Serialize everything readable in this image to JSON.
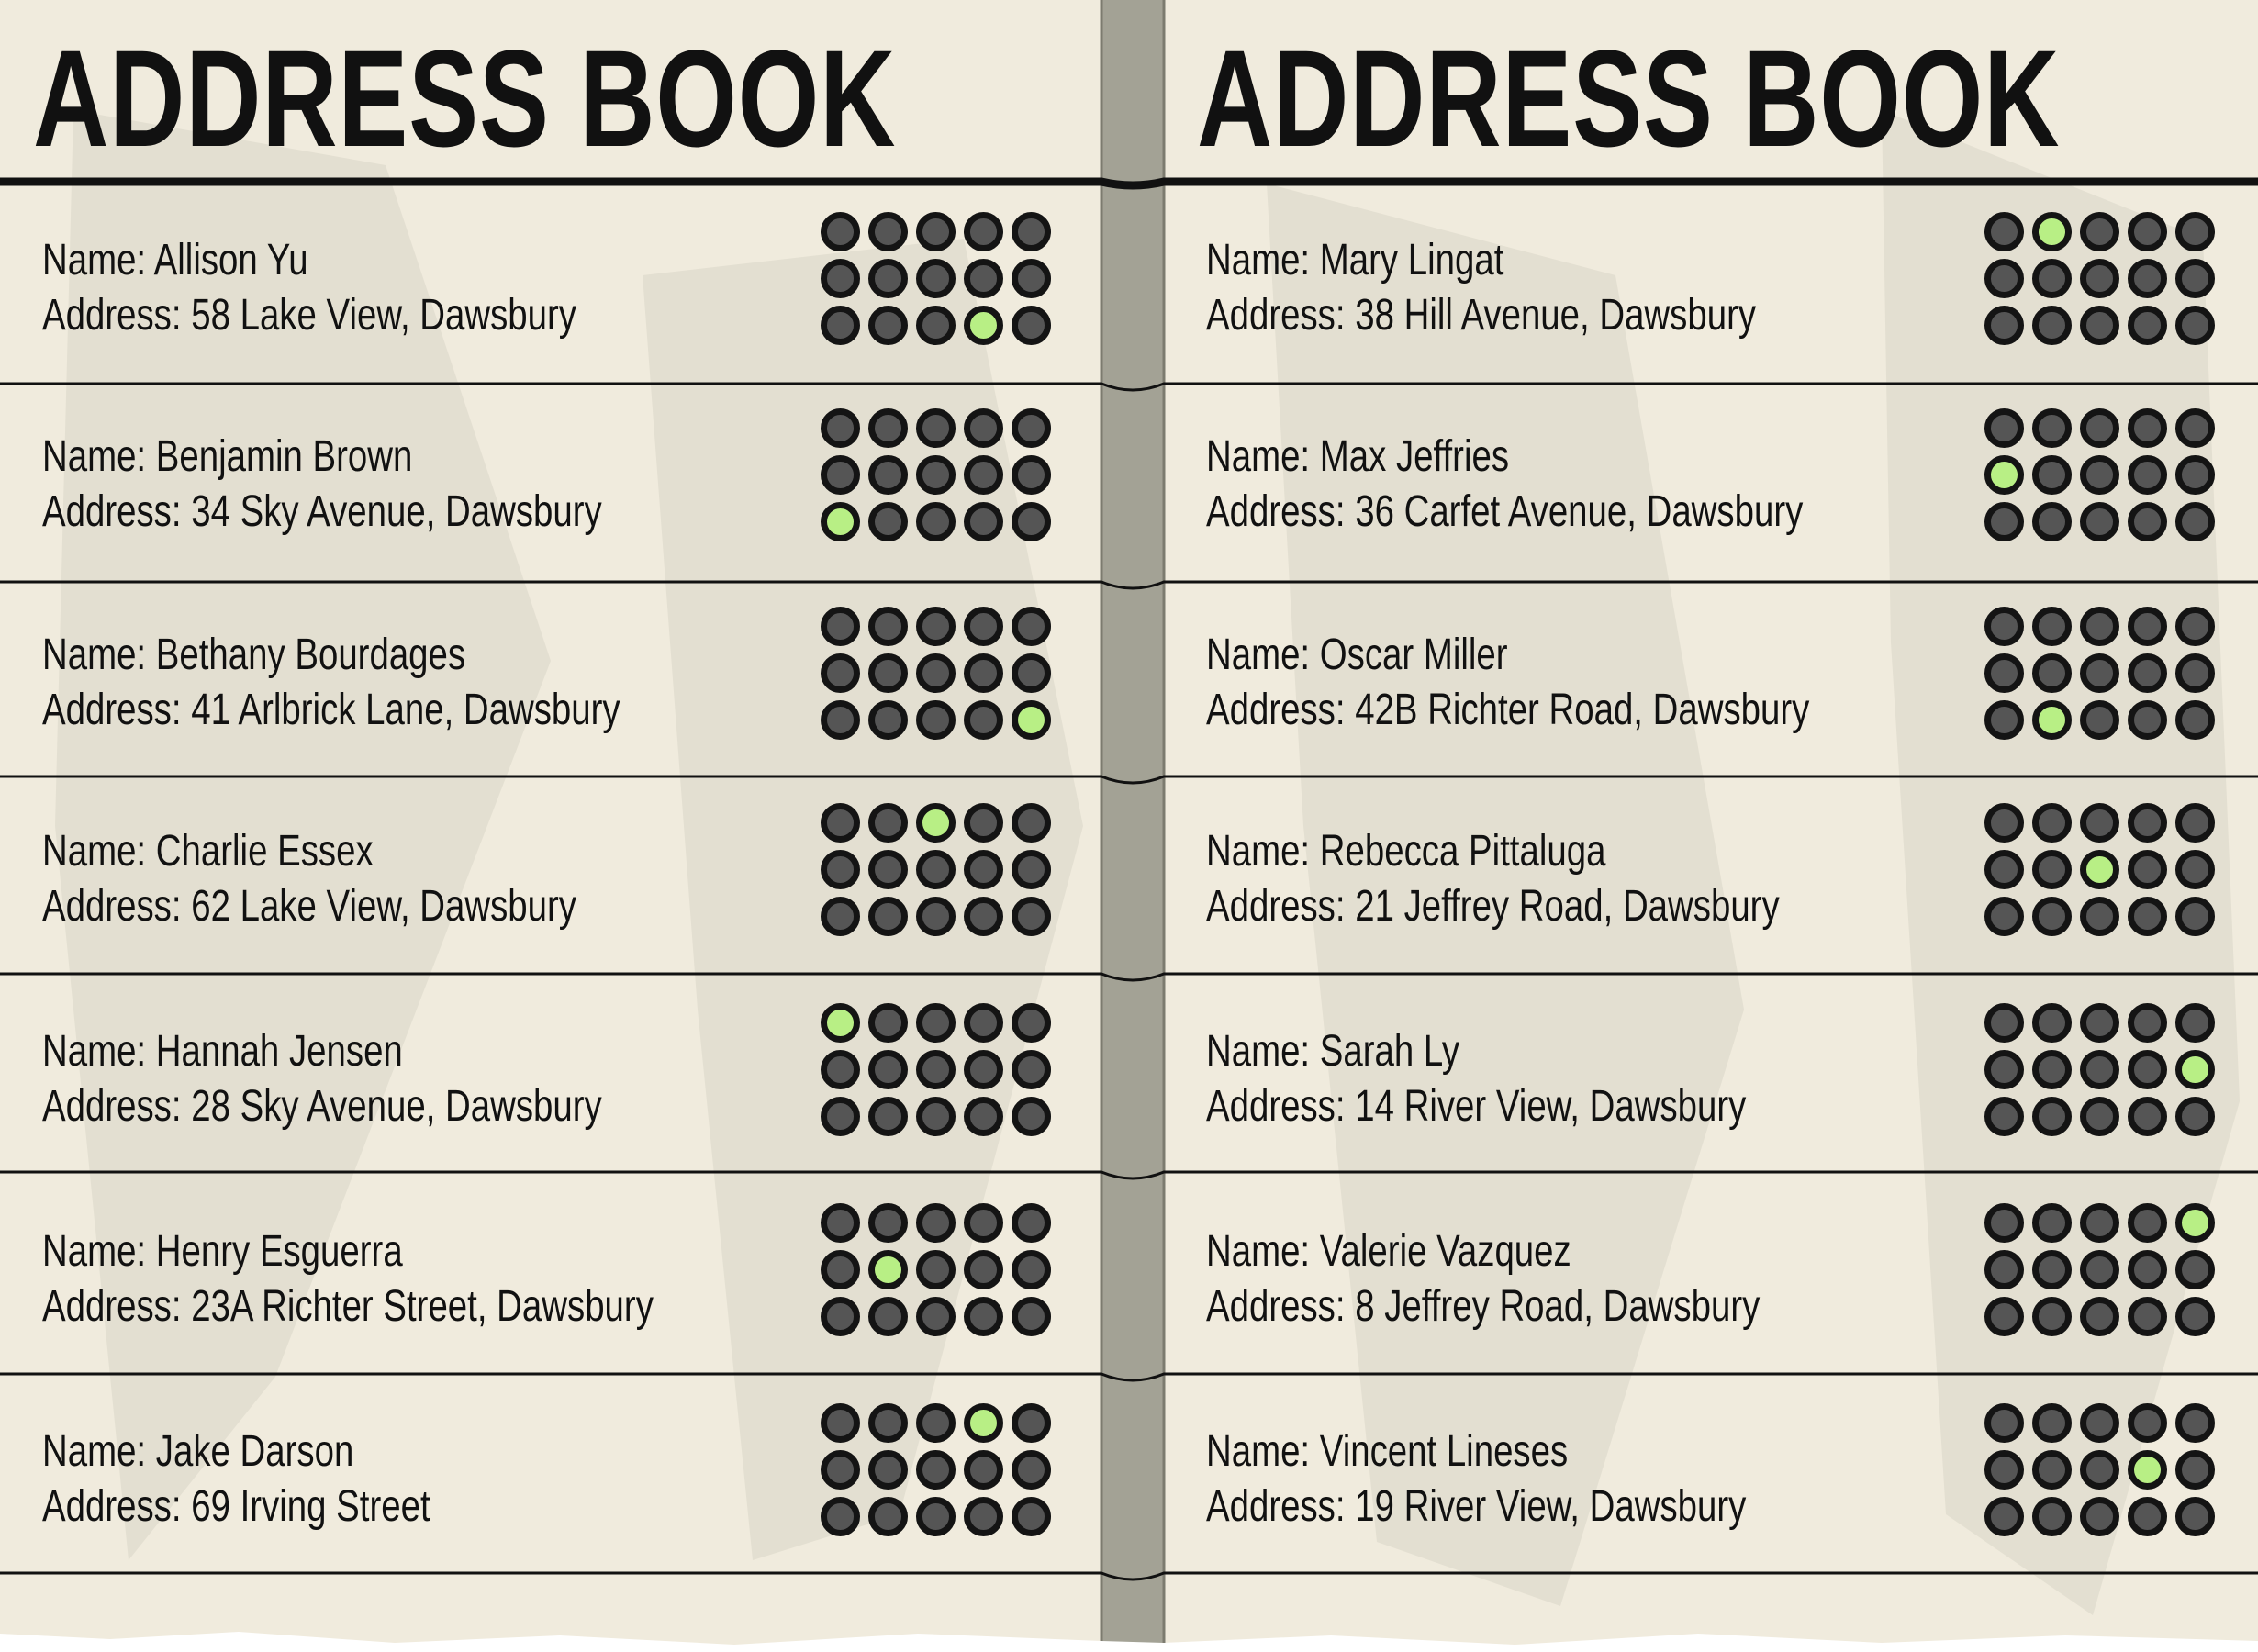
{
  "colors": {
    "paper": "#f0ebdd",
    "spine": "#a3a295",
    "ink": "#111111",
    "dot_off": "#555555",
    "dot_lit": "#b8ef85"
  },
  "grid_shape": {
    "rows": 3,
    "cols": 5
  },
  "pages": [
    {
      "title": "ADDRESS BOOK",
      "entries": [
        {
          "name_line": "Name: Allison Yu",
          "address_line": "Address: 58 Lake View, Dawsbury",
          "lit_dot": {
            "row": 3,
            "col": 4
          }
        },
        {
          "name_line": "Name: Benjamin Brown",
          "address_line": "Address: 34 Sky Avenue, Dawsbury",
          "lit_dot": {
            "row": 3,
            "col": 1
          }
        },
        {
          "name_line": "Name: Bethany Bourdages",
          "address_line": "Address: 41 Arlbrick Lane, Dawsbury",
          "lit_dot": {
            "row": 3,
            "col": 5
          }
        },
        {
          "name_line": "Name: Charlie Essex",
          "address_line": "Address: 62 Lake View, Dawsbury",
          "lit_dot": {
            "row": 1,
            "col": 3
          }
        },
        {
          "name_line": "Name: Hannah Jensen",
          "address_line": "Address: 28 Sky Avenue, Dawsbury",
          "lit_dot": {
            "row": 1,
            "col": 1
          }
        },
        {
          "name_line": "Name: Henry Esguerra",
          "address_line": "Address: 23A Richter Street, Dawsbury",
          "lit_dot": {
            "row": 2,
            "col": 2
          }
        },
        {
          "name_line": "Name: Jake Darson",
          "address_line": "Address: 69 Irving Street",
          "lit_dot": {
            "row": 1,
            "col": 4
          }
        }
      ]
    },
    {
      "title": "ADDRESS BOOK",
      "entries": [
        {
          "name_line": "Name: Mary Lingat",
          "address_line": "Address: 38 Hill Avenue, Dawsbury",
          "lit_dot": {
            "row": 1,
            "col": 2
          }
        },
        {
          "name_line": "Name: Max Jeffries",
          "address_line": "Address: 36 Carfet Avenue, Dawsbury",
          "lit_dot": {
            "row": 2,
            "col": 1
          }
        },
        {
          "name_line": "Name: Oscar Miller",
          "address_line": "Address: 42B Richter Road, Dawsbury",
          "lit_dot": {
            "row": 3,
            "col": 2
          }
        },
        {
          "name_line": "Name: Rebecca Pittaluga",
          "address_line": "Address: 21 Jeffrey Road, Dawsbury",
          "lit_dot": {
            "row": 2,
            "col": 3
          }
        },
        {
          "name_line": "Name: Sarah Ly",
          "address_line": "Address: 14 River View, Dawsbury",
          "lit_dot": {
            "row": 2,
            "col": 5
          }
        },
        {
          "name_line": "Name: Valerie Vazquez",
          "address_line": "Address: 8 Jeffrey Road, Dawsbury",
          "lit_dot": {
            "row": 1,
            "col": 5
          }
        },
        {
          "name_line": "Name: Vincent Lineses",
          "address_line": "Address: 19 River View, Dawsbury",
          "lit_dot": {
            "row": 2,
            "col": 4
          }
        }
      ]
    }
  ]
}
